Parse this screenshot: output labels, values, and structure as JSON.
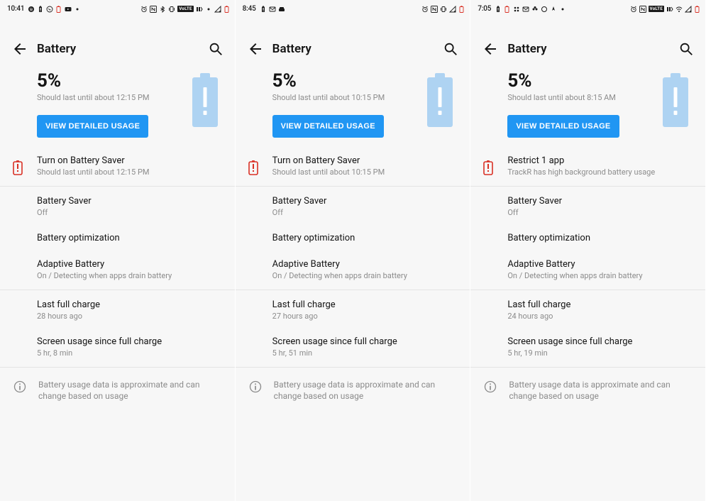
{
  "panes": [
    {
      "status": {
        "time": "10:41",
        "left_icons": [
          "spotify",
          "battery-alert",
          "whatsapp",
          "battery-small",
          "youtube",
          "dot"
        ],
        "right_icons": [
          "alarm",
          "nfc",
          "bluetooth",
          "vibrate",
          "volte",
          "lte",
          "dot2",
          "signal",
          "battery"
        ]
      },
      "title": "Battery",
      "hero": {
        "percent": "5%",
        "estimate": "Should last until about 12:15 PM",
        "button": "VIEW DETAILED USAGE"
      },
      "alert": {
        "title": "Turn on Battery Saver",
        "sub": "Should last until about 12:15 PM"
      },
      "items": [
        {
          "title": "Battery Saver",
          "sub": "Off"
        },
        {
          "title": "Battery optimization",
          "sub": ""
        },
        {
          "title": "Adaptive Battery",
          "sub": "On / Detecting when apps drain battery"
        }
      ],
      "stats": [
        {
          "title": "Last full charge",
          "sub": "28 hours ago"
        },
        {
          "title": "Screen usage since full charge",
          "sub": "5 hr, 8 min"
        }
      ],
      "footer": "Battery usage data is approximate and can change based on usage"
    },
    {
      "status": {
        "time": "8:45",
        "left_icons": [
          "battery-alert",
          "gmail",
          "car"
        ],
        "right_icons": [
          "alarm",
          "nfc",
          "vibrate",
          "signal",
          "battery"
        ]
      },
      "title": "Battery",
      "hero": {
        "percent": "5%",
        "estimate": "Should last until about 10:15 PM",
        "button": "VIEW DETAILED USAGE"
      },
      "alert": {
        "title": "Turn on Battery Saver",
        "sub": "Should last until about 10:15 PM"
      },
      "items": [
        {
          "title": "Battery Saver",
          "sub": "Off"
        },
        {
          "title": "Battery optimization",
          "sub": ""
        },
        {
          "title": "Adaptive Battery",
          "sub": "On / Detecting when apps drain battery"
        }
      ],
      "stats": [
        {
          "title": "Last full charge",
          "sub": "27 hours ago"
        },
        {
          "title": "Screen usage since full charge",
          "sub": "5 hr, 51 min"
        }
      ],
      "footer": "Battery usage data is approximate and can change based on usage"
    },
    {
      "status": {
        "time": "7:05",
        "left_icons": [
          "battery-alert",
          "battery-small",
          "slack",
          "gmail",
          "circles",
          "circle",
          "gps",
          "dot"
        ],
        "right_icons": [
          "alarm",
          "nfc",
          "volte",
          "lte",
          "wifi",
          "signal",
          "battery"
        ]
      },
      "title": "Battery",
      "hero": {
        "percent": "5%",
        "estimate": "Should last until about 8:15 AM",
        "button": "VIEW DETAILED USAGE"
      },
      "alert": {
        "title": "Restrict 1 app",
        "sub": "TrackR has high background battery usage"
      },
      "items": [
        {
          "title": "Battery Saver",
          "sub": "Off"
        },
        {
          "title": "Battery optimization",
          "sub": ""
        },
        {
          "title": "Adaptive Battery",
          "sub": "On / Detecting when apps drain battery"
        }
      ],
      "stats": [
        {
          "title": "Last full charge",
          "sub": "24 hours ago"
        },
        {
          "title": "Screen usage since full charge",
          "sub": "5 hr, 19 min"
        }
      ],
      "footer": "Battery usage data is approximate and can change based on usage"
    }
  ]
}
